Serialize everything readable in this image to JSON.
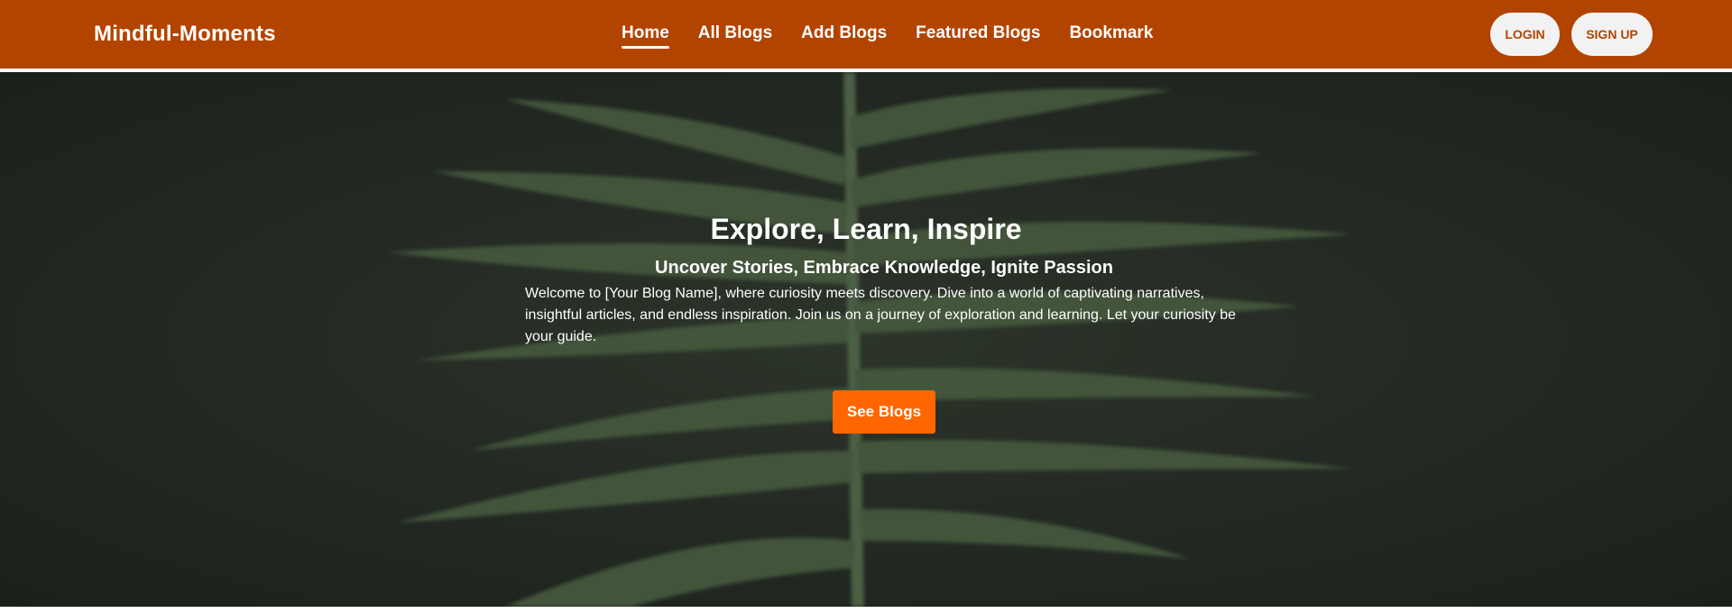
{
  "navbar": {
    "brand": "Mindful-Moments",
    "links": [
      "Home",
      "All Blogs",
      "Add Blogs",
      "Featured Blogs",
      "Bookmark"
    ],
    "active_link": "Home",
    "login_label": "LOGIN",
    "signup_label": "SIGN UP"
  },
  "hero": {
    "title": "Explore, Learn, Inspire",
    "subtitle": "Uncover Stories, Embrace Knowledge, Ignite Passion",
    "text": "Welcome to [Your Blog Name], where curiosity meets discovery. Dive into a world of captivating narratives, insightful articles, and endless inspiration. Join us on a journey of exploration and learning. Let your curiosity be your guide.",
    "cta_label": "See Blogs"
  },
  "colors": {
    "navbar_bg": "#b34400",
    "accent": "#ff6600",
    "auth_button_bg": "#f2f2f2",
    "hero_bg": "#2a322a"
  }
}
